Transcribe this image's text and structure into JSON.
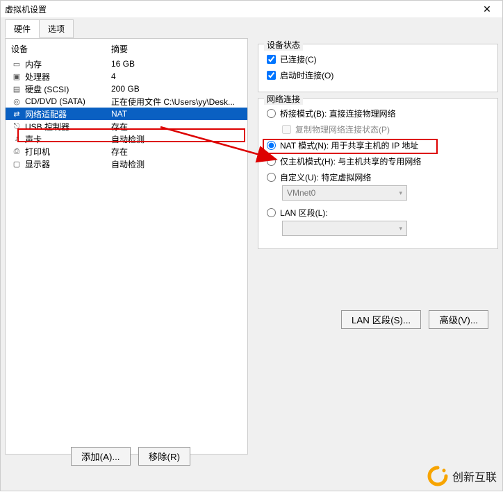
{
  "window": {
    "title": "虚拟机设置",
    "close": "✕"
  },
  "tabs": {
    "hardware": "硬件",
    "options": "选项"
  },
  "columns": {
    "device": "设备",
    "summary": "摘要"
  },
  "devices": {
    "memory": {
      "label": "内存",
      "summary": "16 GB"
    },
    "cpu": {
      "label": "处理器",
      "summary": "4"
    },
    "disk": {
      "label": "硬盘 (SCSI)",
      "summary": "200 GB"
    },
    "cdrom": {
      "label": "CD/DVD (SATA)",
      "summary": "正在使用文件 C:\\Users\\yy\\Desk..."
    },
    "net": {
      "label": "网络适配器",
      "summary": "NAT"
    },
    "usb": {
      "label": "USB 控制器",
      "summary": "存在"
    },
    "sound": {
      "label": "声卡",
      "summary": "自动检测"
    },
    "printer": {
      "label": "打印机",
      "summary": "存在"
    },
    "display": {
      "label": "显示器",
      "summary": "自动检测"
    }
  },
  "buttons": {
    "add": "添加(A)...",
    "remove": "移除(R)",
    "lan_segment": "LAN 区段(S)...",
    "advanced": "高级(V)..."
  },
  "groups": {
    "device_status": {
      "title": "设备状态",
      "connected": "已连接(C)",
      "connect_at_start": "启动时连接(O)"
    },
    "network": {
      "title": "网络连接",
      "bridge": "桥接模式(B): 直接连接物理网络",
      "replicate": "复制物理网络连接状态(P)",
      "nat": "NAT 模式(N): 用于共享主机的 IP 地址",
      "hostonly": "仅主机模式(H): 与主机共享的专用网络",
      "custom": "自定义(U): 特定虚拟网络",
      "custom_net": "VMnet0",
      "lan_seg": "LAN 区段(L):"
    }
  },
  "watermark": {
    "text": "创新互联"
  }
}
